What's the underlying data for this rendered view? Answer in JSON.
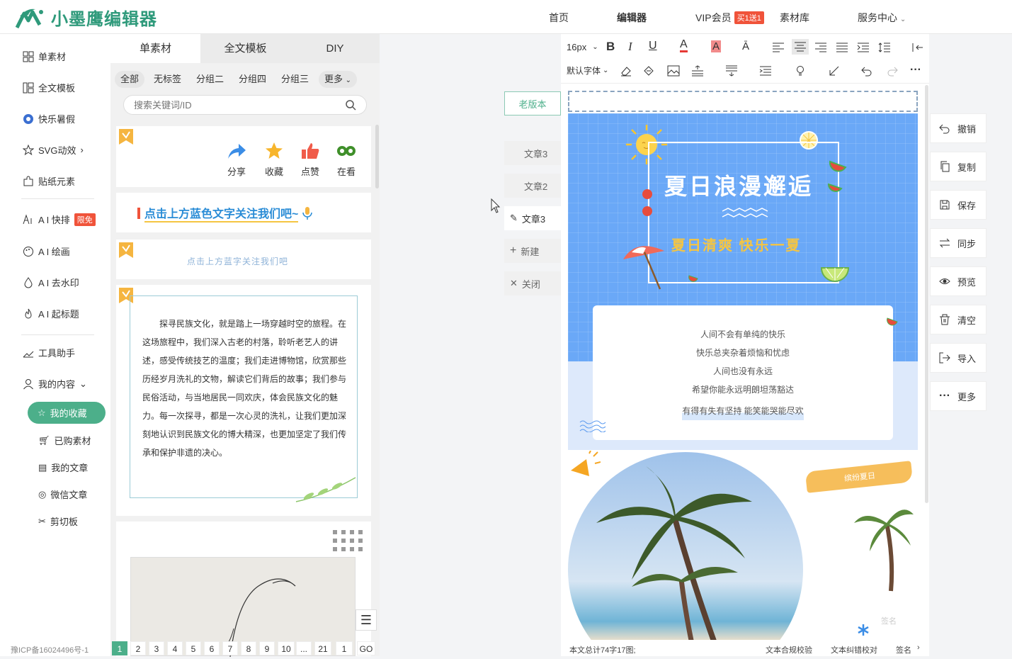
{
  "header": {
    "logo_text": "小墨鹰编辑器",
    "nav": {
      "home": "首页",
      "editor": "编辑器",
      "vip": "VIP会员",
      "vip_badge": "买1送1",
      "library": "素材库",
      "service": "服务中心"
    }
  },
  "sidebar": {
    "items": {
      "single": "单素材",
      "fulltext": "全文模板",
      "summer": "快乐暑假",
      "svg": "SVG动效",
      "sticker": "贴纸元素",
      "ai_layout": "A I 快排",
      "ai_layout_tag": "限免",
      "ai_draw": "A I 绘画",
      "ai_watermark": "A I 去水印",
      "ai_title": "A I 起标题",
      "tools": "工具助手",
      "my_content": "我的内容"
    },
    "sub": {
      "favorites": "我的收藏",
      "purchased": "已购素材",
      "articles": "我的文章",
      "wechat": "微信文章",
      "clipboard": "剪切板"
    },
    "icp": "豫ICP备16024496号-1"
  },
  "panel": {
    "tabs": [
      "单素材",
      "全文模板",
      "DIY"
    ],
    "filters": [
      "全部",
      "无标签",
      "分组二",
      "分组四",
      "分组三",
      "更多"
    ],
    "search_placeholder": "搜索关键词/ID",
    "share_row": {
      "share": "分享",
      "collect": "收藏",
      "like": "点赞",
      "watching": "在看"
    },
    "follow_title": "点击上方蓝色文字关注我们吧~",
    "follow_sub": "点击上方蓝字关注我们吧",
    "article": "探寻民族文化，就是踏上一场穿越时空的旅程。在这场旅程中，我们深入古老的村落，聆听老艺人的讲述，感受传统技艺的温度；我们走进博物馆，欣赏那些历经岁月洗礼的文物，解读它们背后的故事；我们参与民俗活动，与当地居民一同欢庆，体会民族文化的魅力。每一次探寻，都是一次心灵的洗礼，让我们更加深刻地认识到民族文化的博大精深，也更加坚定了我们传承和保护非遗的决心。",
    "pages": [
      "1",
      "2",
      "3",
      "4",
      "5",
      "6",
      "7",
      "8",
      "9",
      "10",
      "...",
      "21"
    ],
    "page_input": "1",
    "go": "GO"
  },
  "middle": {
    "old_version": "老版本",
    "docs": [
      "文章3",
      "文章2",
      "文章3"
    ],
    "new": "新建",
    "close": "关闭"
  },
  "toolbar": {
    "font_size": "16px",
    "font_family": "默认字体"
  },
  "canvas": {
    "title": "夏日浪漫邂逅",
    "subtitle": "夏日清爽 快乐一夏",
    "poem": [
      "人间不会有单纯的快乐",
      "快乐总夹杂着烦恼和忧虑",
      "人间也没有永远",
      "希望你能永远明朗坦荡豁达",
      "有得有失有坚持 能笑能哭能尽欢"
    ],
    "brush_text": "缤纷夏日",
    "sign": "签名"
  },
  "statusbar": {
    "count": "本文总计74字17图;",
    "compliance": "文本合规校验",
    "typo": "文本纠错校对",
    "sign": "签名"
  },
  "right_actions": [
    "撤销",
    "复制",
    "保存",
    "同步",
    "预览",
    "清空",
    "导入",
    "更多"
  ],
  "colors": {
    "brand": "#2f9a7b",
    "accent_green": "#4caf8a",
    "sky_blue": "#6aa8f7",
    "title_gold": "#f5c542",
    "vip_red": "#f0533a"
  }
}
